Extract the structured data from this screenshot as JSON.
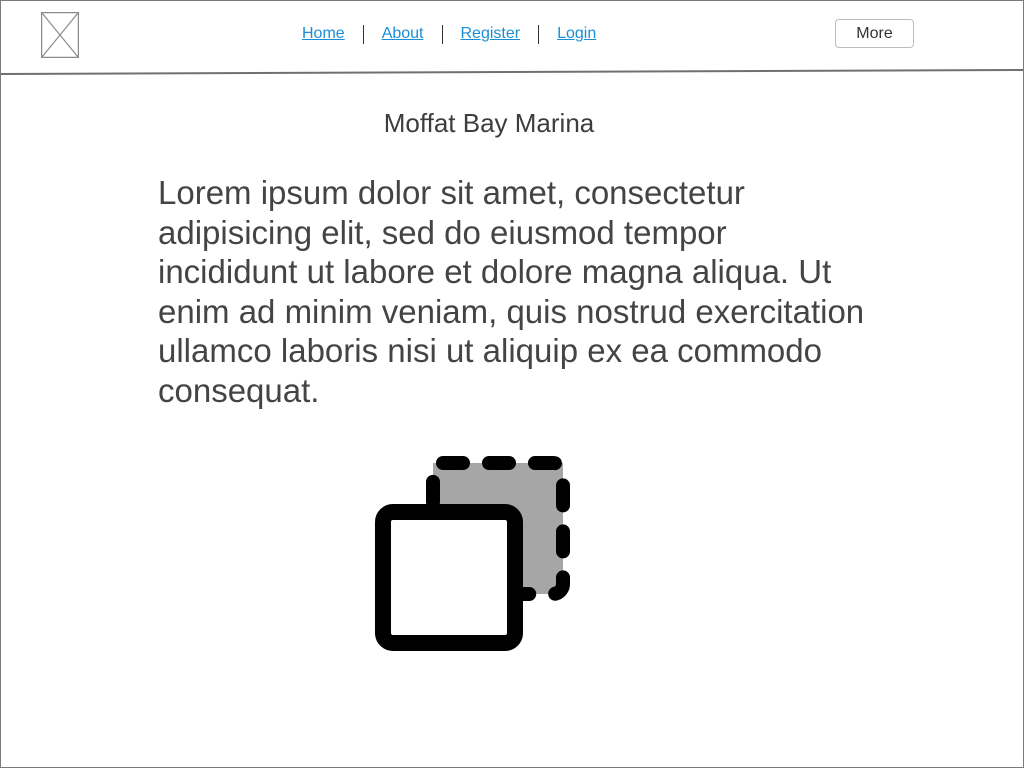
{
  "nav": {
    "items": [
      {
        "label": "Home"
      },
      {
        "label": "About"
      },
      {
        "label": "Register"
      },
      {
        "label": "Login"
      }
    ],
    "more_label": "More"
  },
  "main": {
    "title": "Moffat Bay Marina",
    "body": "Lorem ipsum dolor sit amet, consectetur adipisicing elit, sed do eiusmod tempor incididunt ut labore et dolore magna aliqua. Ut enim ad minim veniam, quis nostrud exercitation ullamco laboris nisi ut aliquip ex ea commodo consequat."
  },
  "icons": {
    "logo": "image-placeholder-icon",
    "graphic": "copy-duplicate-icon"
  },
  "colors": {
    "link": "#1a8fd6",
    "text": "#444444",
    "border": "#7a7a7a",
    "graphic_fill": "#a6a6a6",
    "graphic_stroke": "#000000"
  }
}
